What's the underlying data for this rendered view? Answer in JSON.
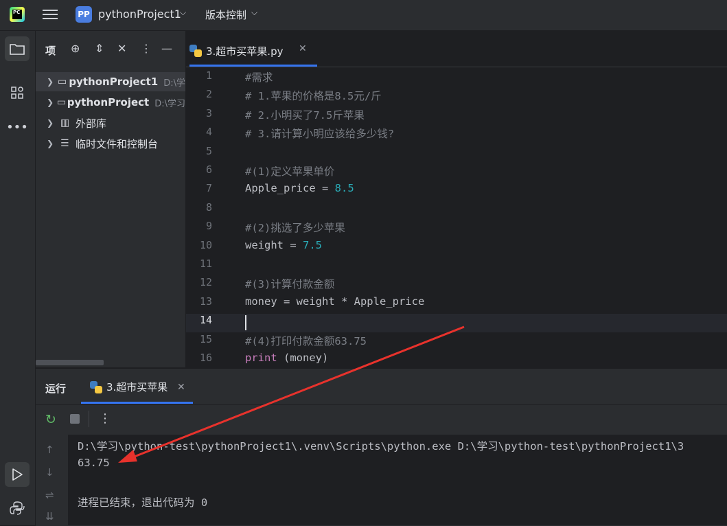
{
  "titlebar": {
    "logo_text": "PC",
    "project_badge": "PP",
    "project_name": "pythonProject1",
    "vcs_menu": "版本控制"
  },
  "project_panel": {
    "title": "项",
    "tree": [
      {
        "name": "pythonProject1",
        "path": "D:\\学",
        "bold": true,
        "icon": "folder-icon"
      },
      {
        "name": "pythonProject",
        "path": "D:\\学习",
        "bold": true,
        "icon": "folder-icon"
      },
      {
        "name": "外部库",
        "path": "",
        "bold": false,
        "icon": "library-icon"
      },
      {
        "name": "临时文件和控制台",
        "path": "",
        "bold": false,
        "icon": "scratches-icon"
      }
    ]
  },
  "editor": {
    "tab_label": "3.超市买苹果.py",
    "current_line": 14,
    "lines": [
      {
        "n": "1",
        "text": "#需求"
      },
      {
        "n": "2",
        "text": "# 1.苹果的价格是8.5元/斤"
      },
      {
        "n": "3",
        "text": "# 2.小明买了7.5斤苹果"
      },
      {
        "n": "4",
        "text": "# 3.请计算小明应该给多少钱?"
      },
      {
        "n": "5",
        "text": ""
      },
      {
        "n": "6",
        "text": "#(1)定义苹果单价"
      },
      {
        "n": "7",
        "text": "Apple_price = 8.5"
      },
      {
        "n": "8",
        "text": ""
      },
      {
        "n": "9",
        "text": "#(2)挑选了多少苹果"
      },
      {
        "n": "10",
        "text": "weight = 7.5"
      },
      {
        "n": "11",
        "text": ""
      },
      {
        "n": "12",
        "text": "#(3)计算付款金额"
      },
      {
        "n": "13",
        "text": "money = weight * Apple_price"
      },
      {
        "n": "14",
        "text": ""
      },
      {
        "n": "15",
        "text": "#(4)打印付款金额63.75"
      },
      {
        "n": "16",
        "text": "print (money)"
      }
    ]
  },
  "run_panel": {
    "title": "运行",
    "tab_label": "3.超市买苹果",
    "output": [
      "D:\\学习\\python-test\\pythonProject1\\.venv\\Scripts\\python.exe D:\\学习\\python-test\\pythonProject1\\3",
      "63.75",
      "",
      "进程已结束，退出代码为 0"
    ]
  },
  "colors": {
    "accent": "#3574f0",
    "annotation_arrow": "#e8322c",
    "run_green": "#5fb865"
  }
}
